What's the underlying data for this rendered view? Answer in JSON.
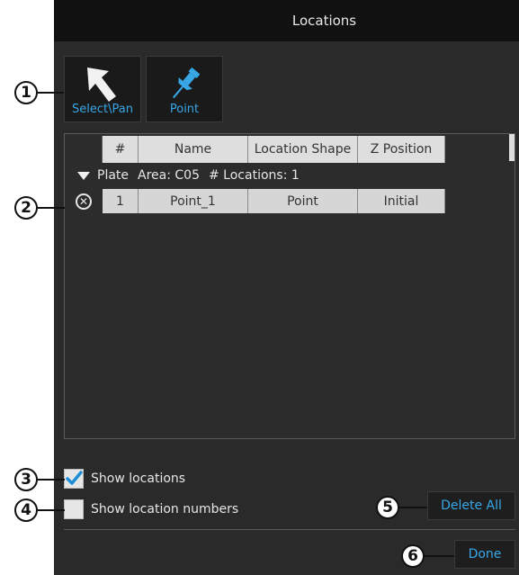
{
  "window": {
    "title": "Locations"
  },
  "tools": [
    {
      "label": "Select\\Pan",
      "icon": "select-pan-arrow-icon",
      "color": "#ffffff"
    },
    {
      "label": "Point",
      "icon": "pushpin-icon",
      "color": "#38a7e6"
    }
  ],
  "table": {
    "columns": [
      "",
      "#",
      "Name",
      "Location Shape",
      "Z Position"
    ],
    "group": {
      "plate": "Plate",
      "area_label": "Area: C05",
      "count_label": "# Locations: 1"
    },
    "rows": [
      {
        "index": "1",
        "name": "Point_1",
        "shape": "Point",
        "z": "Initial"
      }
    ]
  },
  "options": {
    "show_locations": {
      "label": "Show locations",
      "checked": true
    },
    "show_location_numbers": {
      "label": "Show location numbers",
      "checked": false
    }
  },
  "buttons": {
    "delete_all": "Delete All",
    "done": "Done"
  },
  "callouts": [
    "1",
    "2",
    "3",
    "4",
    "5",
    "6"
  ],
  "colors": {
    "accent": "#38a7e6",
    "panel": "#2a2a2a",
    "titlebar": "#111111"
  }
}
